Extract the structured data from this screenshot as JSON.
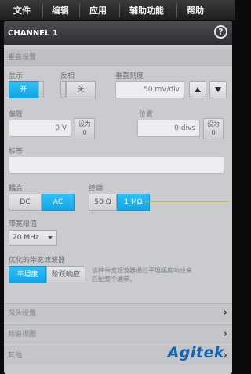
{
  "menu": {
    "items": [
      "文件",
      "编辑",
      "应用",
      "辅助功能",
      "帮助"
    ]
  },
  "panel": {
    "title": "CHANNEL 1",
    "help_icon": "help-circle-icon",
    "help_glyph": "?"
  },
  "vertical": {
    "header": "垂直设置",
    "display_label": "显示",
    "display_on": "开",
    "invert_label": "反相",
    "invert_off": "关",
    "scale_label": "垂直刻度",
    "scale_value": "50 mV/div",
    "offset_label": "偏置",
    "offset_value": "0 V",
    "offset_set_line1": "设为",
    "offset_set_line2": "0",
    "position_label": "位置",
    "position_value": "0 divs",
    "position_set_line1": "设为",
    "position_set_line2": "0",
    "tag_label": "标签",
    "tag_value": ""
  },
  "coupling": {
    "label": "耦合",
    "options": [
      "DC",
      "AC"
    ],
    "selected": "AC"
  },
  "termination": {
    "label": "终端",
    "options": [
      "50 Ω",
      "1 MΩ"
    ],
    "selected": "1 MΩ"
  },
  "bandwidth": {
    "label": "带宽限值",
    "value": "20 MHz"
  },
  "filter": {
    "label": "优化的带宽滤波器",
    "options": [
      "平坦度",
      "阶跃响应"
    ],
    "selected": "平坦度",
    "description_line1": "该种带宽滤波器通过平坦幅度响应来",
    "description_line2": "匹配整个通带。"
  },
  "sections": [
    {
      "label": "探头设置"
    },
    {
      "label": "频谱视图"
    },
    {
      "label": "其他"
    }
  ],
  "logo": {
    "text": "Agitek"
  },
  "colors": {
    "accent": "#18aeea",
    "panel_bg": "#c9cbcf",
    "title_bar": "#3a3b40",
    "logo": "#1464b4"
  }
}
